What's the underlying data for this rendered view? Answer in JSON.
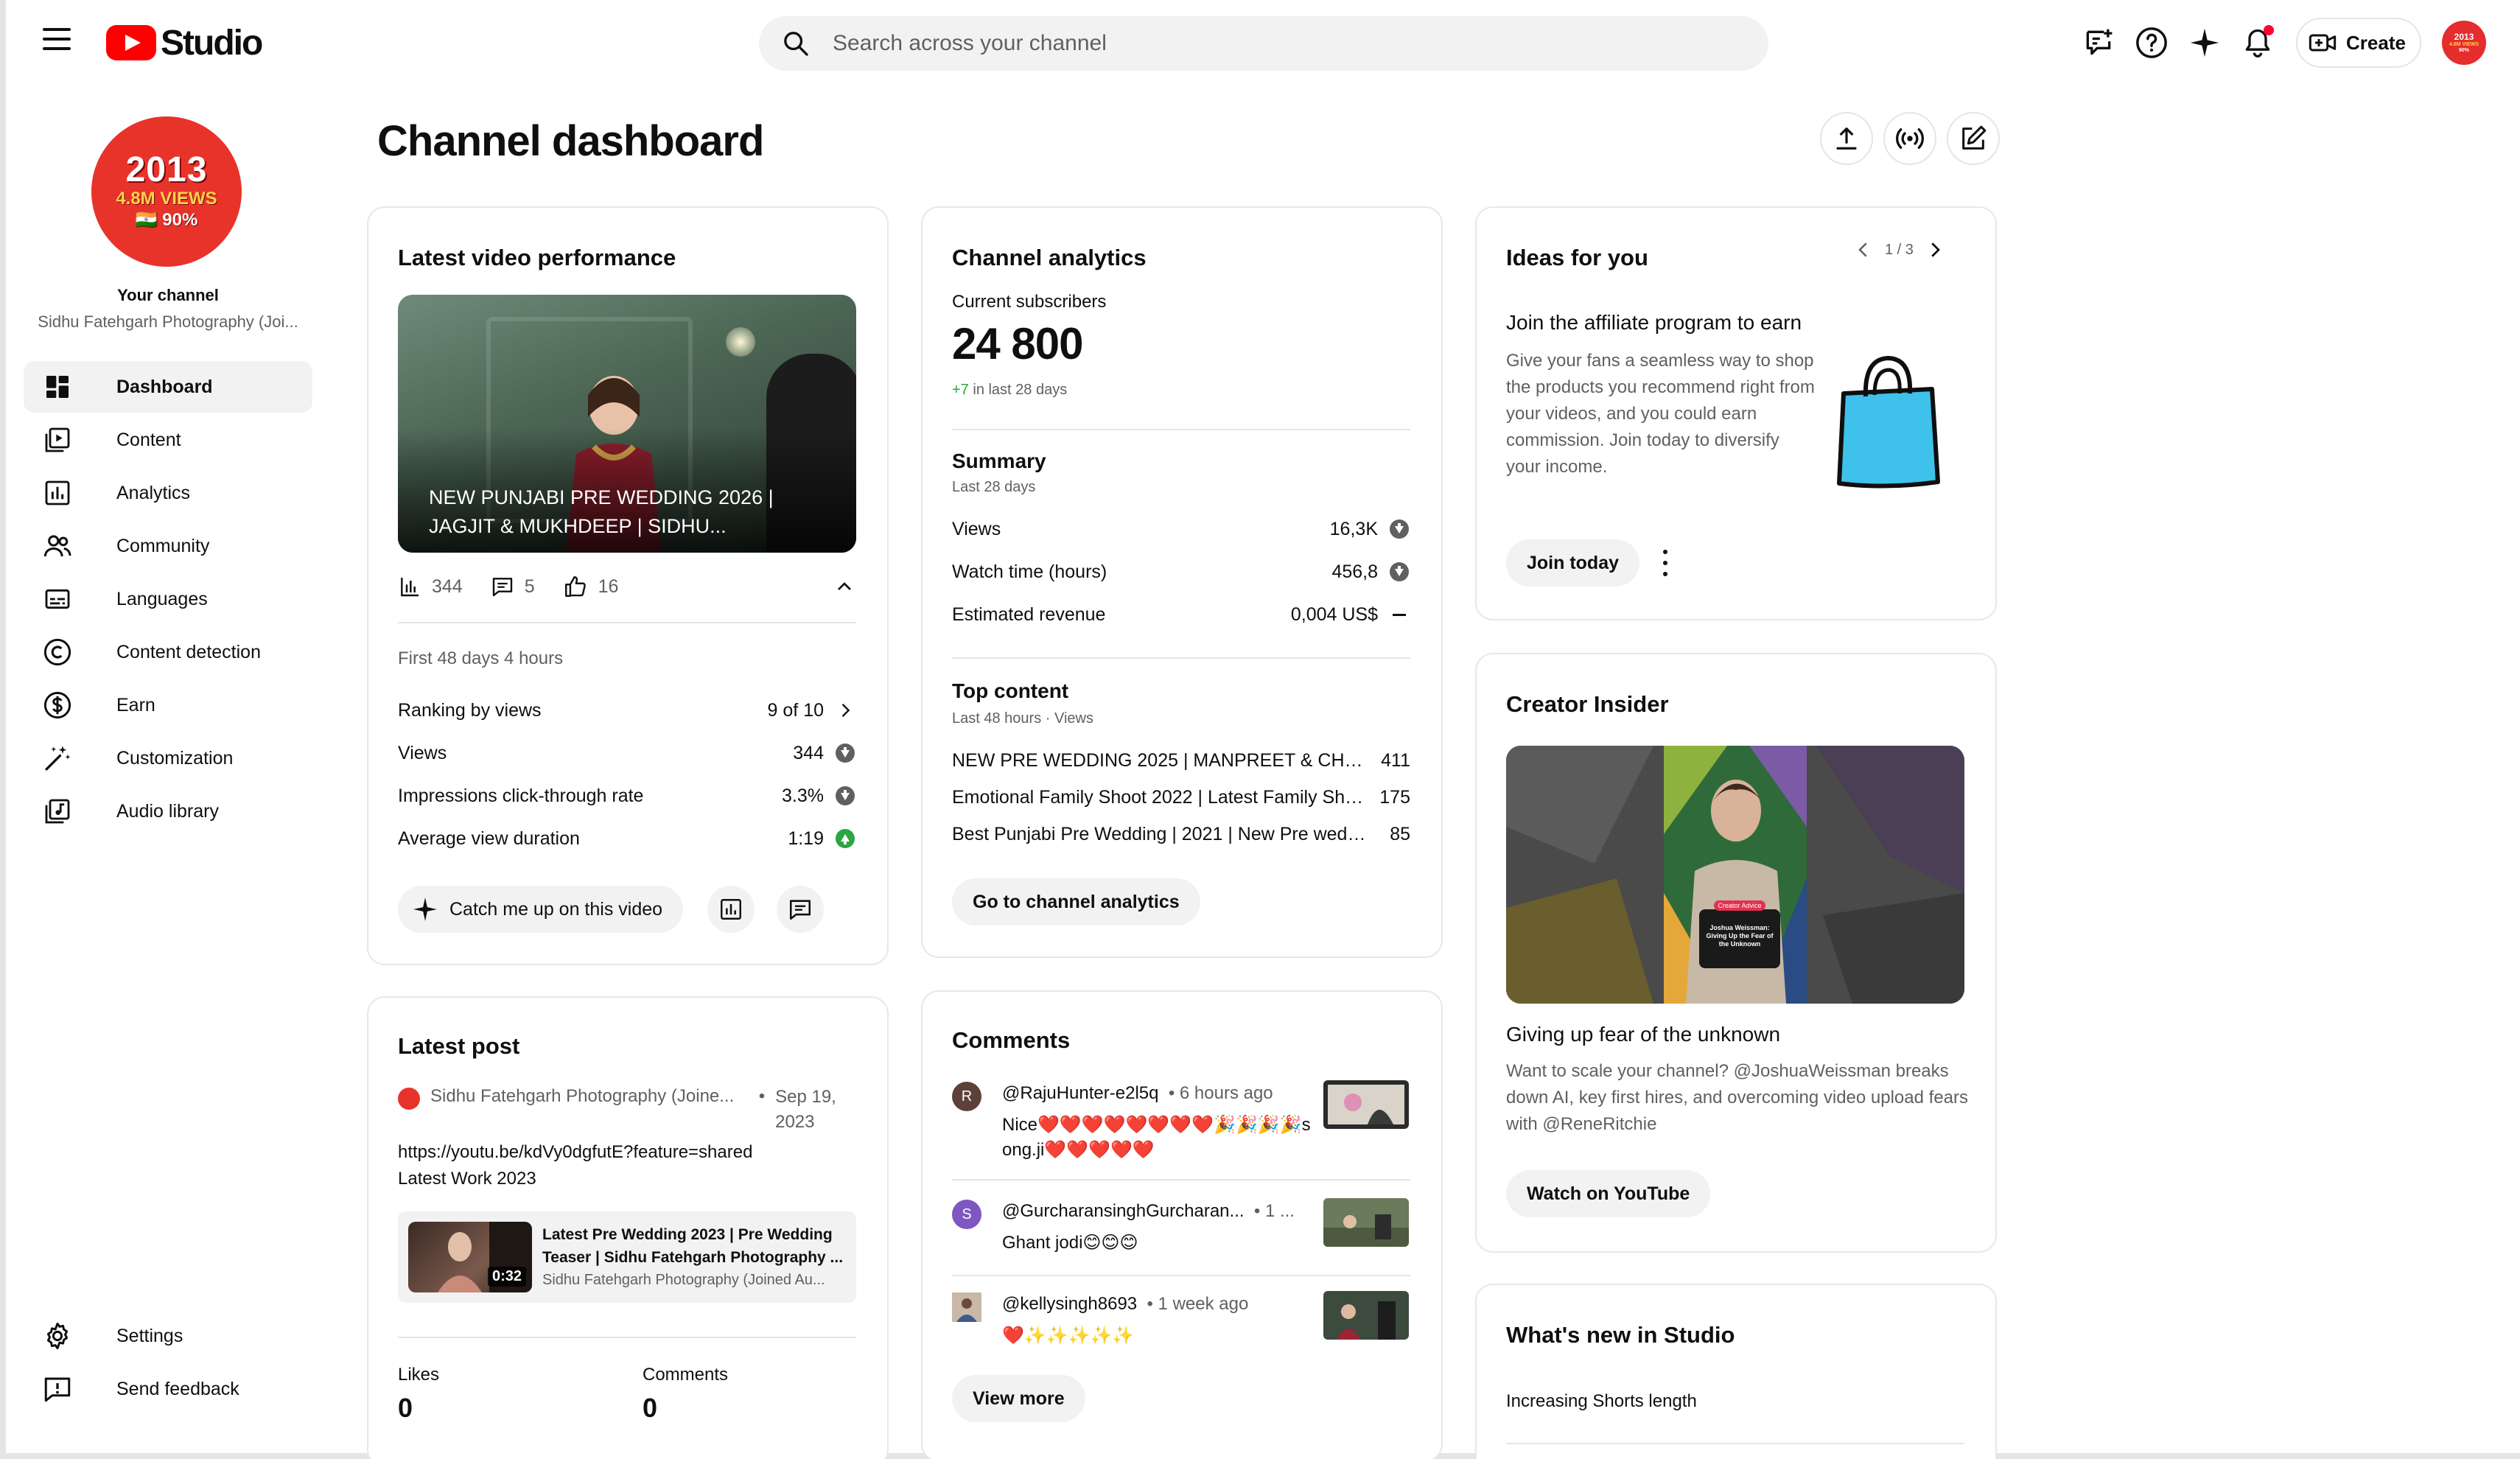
{
  "app": {
    "logo_text": "Studio"
  },
  "search": {
    "placeholder": "Search across your channel"
  },
  "topbar": {
    "create_label": "Create",
    "avatar_year": "2013",
    "avatar_views": "4.8M VIEWS",
    "avatar_pct": "90%"
  },
  "sidebar": {
    "channel_avatar": {
      "year": "2013",
      "views": "4.8M VIEWS",
      "pct": "🇮🇳 90%"
    },
    "your_channel": "Your channel",
    "channel_name": "Sidhu Fatehgarh Photography (Joi...",
    "items": [
      {
        "label": "Dashboard",
        "icon": "dashboard-icon",
        "active": true
      },
      {
        "label": "Content",
        "icon": "content-icon"
      },
      {
        "label": "Analytics",
        "icon": "analytics-icon"
      },
      {
        "label": "Community",
        "icon": "community-icon"
      },
      {
        "label": "Languages",
        "icon": "subtitles-icon"
      },
      {
        "label": "Content detection",
        "icon": "copyright-icon"
      },
      {
        "label": "Earn",
        "icon": "dollar-icon"
      },
      {
        "label": "Customization",
        "icon": "magic-wand-icon"
      },
      {
        "label": "Audio library",
        "icon": "audio-library-icon"
      }
    ],
    "bottom": [
      {
        "label": "Settings",
        "icon": "gear-icon"
      },
      {
        "label": "Send feedback",
        "icon": "feedback-icon"
      }
    ]
  },
  "page": {
    "title": "Channel dashboard"
  },
  "latest_video": {
    "title": "Latest video performance",
    "video_title": "NEW PUNJABI PRE WEDDING 2026 | JAGJIT & MUKHDEEP | SIDHU...",
    "views": "344",
    "comments": "5",
    "likes": "16",
    "period": "First 48 days 4 hours",
    "rows": [
      {
        "label": "Ranking by views",
        "value": "9 of 10"
      },
      {
        "label": "Views",
        "value": "344"
      },
      {
        "label": "Impressions click-through rate",
        "value": "3.3%"
      },
      {
        "label": "Average view duration",
        "value": "1:19"
      }
    ],
    "catch_up": "Catch me up on this video"
  },
  "analytics": {
    "title": "Channel analytics",
    "subs_label": "Current subscribers",
    "subs_value": "24 800",
    "subs_delta": "+7",
    "subs_delta_suffix": " in last 28 days",
    "summary_title": "Summary",
    "summary_period": "Last 28 days",
    "summary": [
      {
        "label": "Views",
        "value": "16,3K"
      },
      {
        "label": "Watch time (hours)",
        "value": "456,8"
      },
      {
        "label": "Estimated revenue",
        "value": "0,004 US$"
      }
    ],
    "top_title": "Top content",
    "top_period": "Last 48 hours · Views",
    "top": [
      {
        "title": "NEW PRE WEDDING 2025 | MANPREET & CHAR...",
        "views": "411"
      },
      {
        "title": "Emotional Family Shoot 2022 | Latest Family Sho...",
        "views": "175"
      },
      {
        "title": "Best Punjabi Pre Wedding | 2021 | New Pre wedd...",
        "views": "85"
      }
    ],
    "button": "Go to channel analytics"
  },
  "ideas": {
    "title": "Ideas for you",
    "pager": "1 / 3",
    "heading": "Join the affiliate program to earn",
    "body": "Give your fans a seamless way to shop the products you recommend right from your videos, and you could earn commission. Join today to diversify your income.",
    "button": "Join today"
  },
  "creator_insider": {
    "title": "Creator Insider",
    "badge": "Creator Advice",
    "card_text": "Joshua Weissman: Giving Up the Fear of the Unknown",
    "heading": "Giving up fear of the unknown",
    "body": "Want to scale your channel? @JoshuaWeissman breaks down AI, key first hires, and overcoming video upload fears with @ReneRitchie",
    "button": "Watch on YouTube"
  },
  "latest_post": {
    "title": "Latest post",
    "author": "Sidhu Fatehgarh Photography (Joine...",
    "date": "Sep 19, 2023",
    "text_line1": "https://youtu.be/kdVy0dgfutE?feature=shared",
    "text_line2": "Latest Work 2023",
    "embed_title": "Latest Pre Wedding 2023 | Pre Wedding Teaser | Sidhu Fatehgarh Photography ...",
    "embed_channel": "Sidhu Fatehgarh Photography (Joined Au...",
    "embed_duration": "0:32",
    "likes_label": "Likes",
    "likes_value": "0",
    "comments_label": "Comments",
    "comments_value": "0"
  },
  "comments": {
    "title": "Comments",
    "items": [
      {
        "initial": "R",
        "avatar_color": "#5d4037",
        "handle": "@RajuHunter-e2l5q",
        "time": "6 hours ago",
        "text": "Nice❤️❤️❤️❤️❤️❤️❤️❤️🎉🎉🎉🎉song.ji❤️❤️❤️❤️❤️"
      },
      {
        "initial": "S",
        "avatar_color": "#7e57c2",
        "handle": "@GurcharansinghGurcharan...",
        "time": "1 ...",
        "text": "Ghant jodi😊😊😊"
      },
      {
        "initial": "",
        "avatar_color": "#8d6e63",
        "handle": "@kellysingh8693",
        "time": "1 week ago",
        "text": "❤️✨✨✨✨✨"
      }
    ],
    "button": "View more"
  },
  "whats_new": {
    "title": "What's new in Studio",
    "item": "Increasing Shorts length"
  }
}
